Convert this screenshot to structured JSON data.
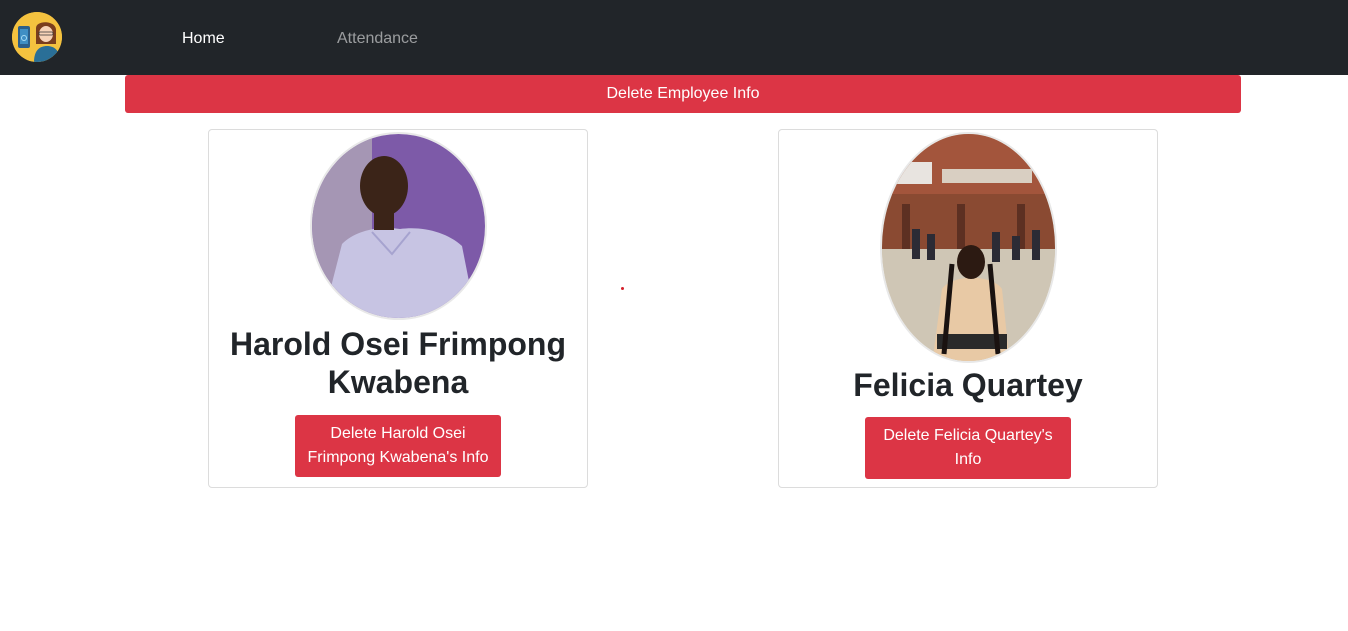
{
  "nav": {
    "logo_icon": "app-logo-icon",
    "home": "Home",
    "attendance": "Attendance"
  },
  "banner": {
    "label": "Delete Employee Info"
  },
  "employees": [
    {
      "name": "Harold Osei Frimpong Kwabena",
      "button": "Delete Harold Osei Frimpong Kwabena's Info"
    },
    {
      "name": "Felicia Quartey",
      "button": "Delete Felicia Quartey's Info"
    }
  ],
  "colors": {
    "navbar": "#212529",
    "danger": "#dc3545"
  }
}
